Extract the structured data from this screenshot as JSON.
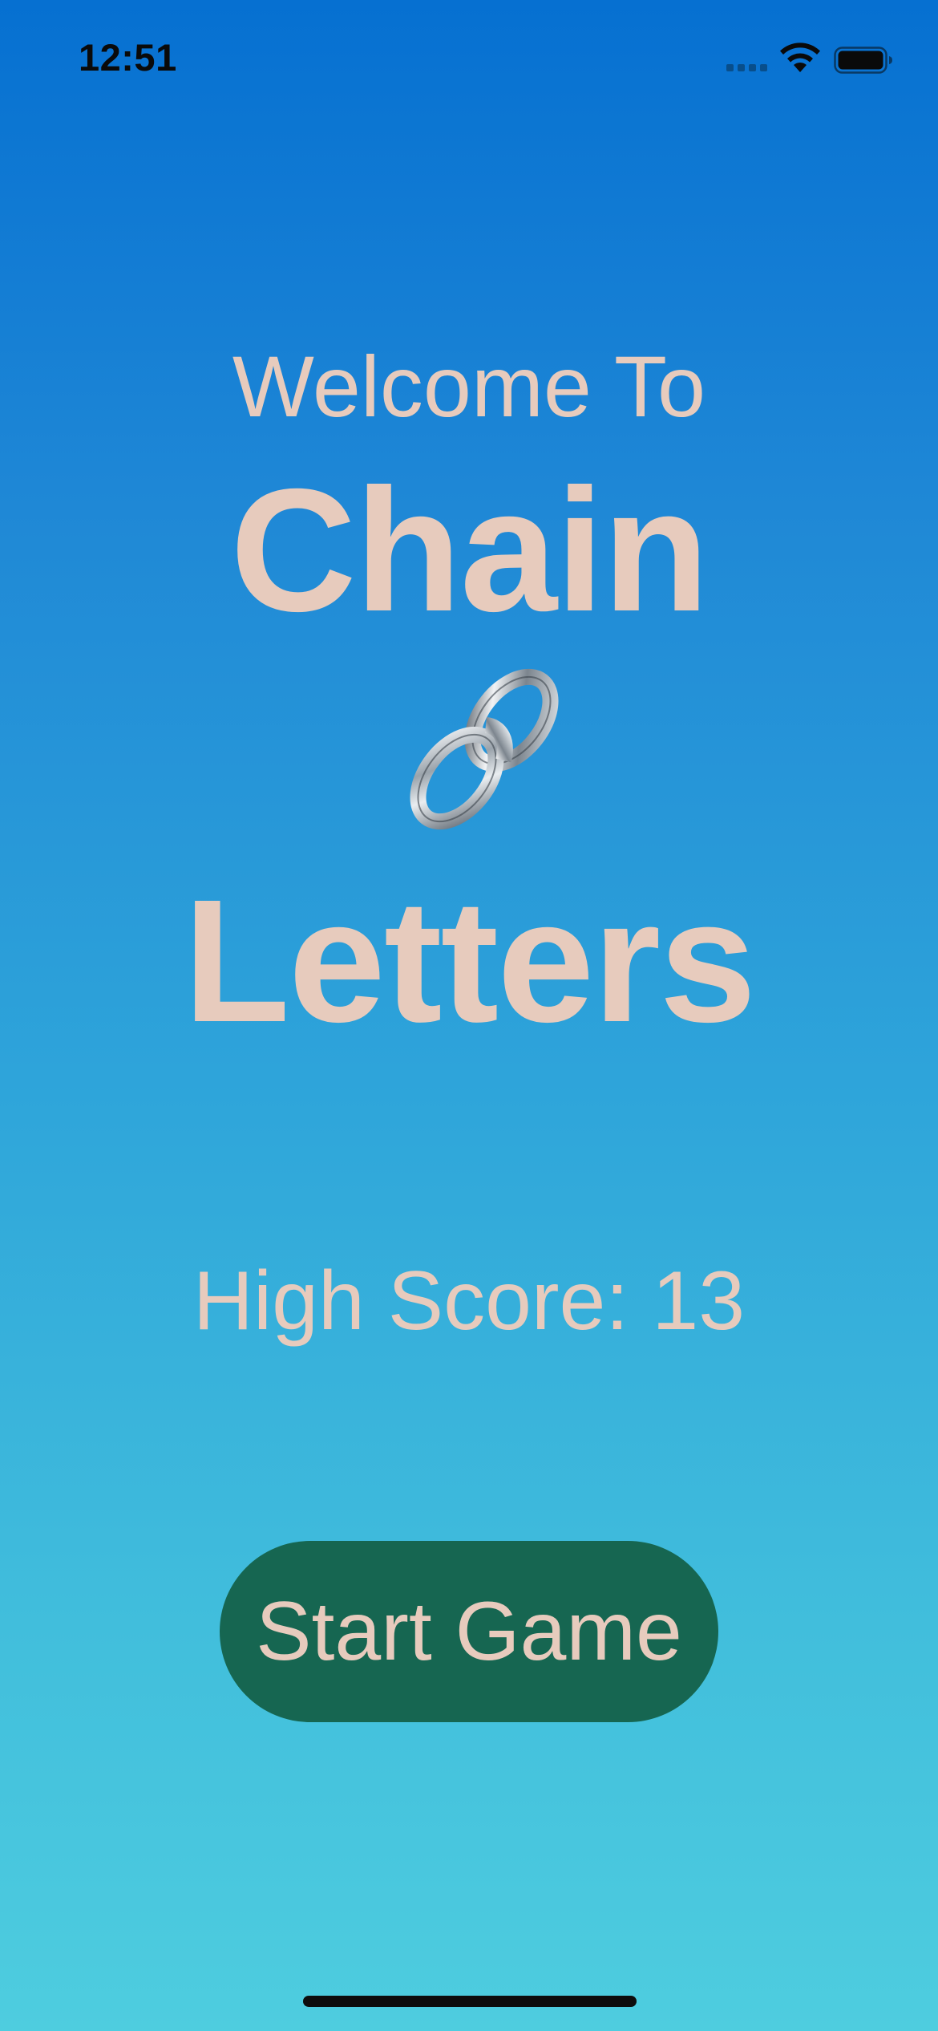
{
  "status_bar": {
    "time": "12:51",
    "icons": [
      "cellular-signal-icon",
      "wifi-icon",
      "battery-icon"
    ]
  },
  "welcome": {
    "line1": "Welcome To",
    "title_top": "Chain",
    "emoji": "link-emoji",
    "title_bottom": "Letters"
  },
  "high_score": {
    "label": "High Score:",
    "value": "13"
  },
  "start_button": {
    "label": "Start Game"
  },
  "colors": {
    "gradient_top": "#0670d1",
    "gradient_bottom": "#4ecddf",
    "text": "#e7cbbd",
    "button": "#166651"
  }
}
